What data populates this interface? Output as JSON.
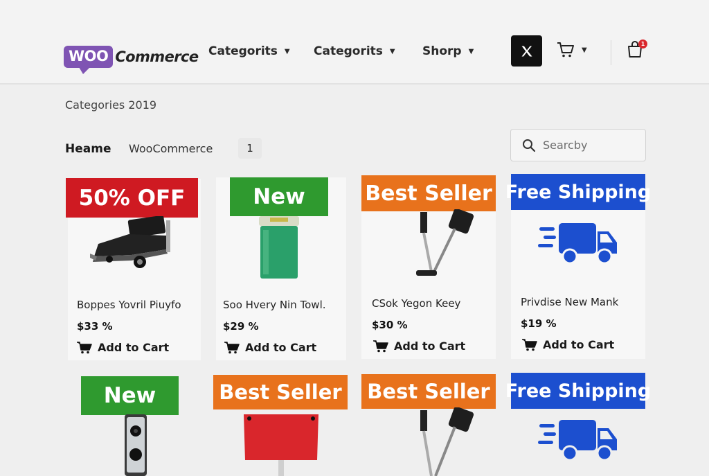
{
  "header": {
    "logo_woo": "WOO",
    "logo_commerce": "Commerce",
    "nav": [
      {
        "label": "Categorits"
      },
      {
        "label": "Categorits"
      },
      {
        "label": "Shorp"
      }
    ],
    "x_label": "𝕏",
    "bag_count": "1"
  },
  "page": {
    "subtitle": "Categories 2019",
    "breadcrumb": {
      "home": "Heame",
      "section": "WooCommerce",
      "page": "1"
    },
    "search_placeholder": "Searcby"
  },
  "colors": {
    "sale_red": "#cf1a22",
    "new_green": "#2f9a2f",
    "best_orange": "#e8721c",
    "shipping_blue": "#1c4fcf"
  },
  "products": [
    {
      "badge": "50% OFF",
      "name": "Boppes Yovril Piuyfo",
      "price": "$33 %",
      "cta": "Add to Cart",
      "image": "black-cart-chair"
    },
    {
      "badge": "New",
      "name": "Soo Hvery Nin Towl.",
      "price": "$29 %",
      "cta": "Add to Cart",
      "image": "green-bin"
    },
    {
      "badge": "Best Seller",
      "name": "CSok Yegon Keey",
      "price": "$30 %",
      "cta": "Add to Cart",
      "image": "stick-vacuum"
    },
    {
      "badge": "Free Shipping",
      "name": "Privdise New Mank",
      "price": "$19 %",
      "cta": "Add to Cart",
      "image": "delivery-truck-icon"
    },
    {
      "badge": "New",
      "image": "video-doorbell"
    },
    {
      "badge": "Best Seller",
      "image": "red-flag-bag"
    },
    {
      "badge": "Best Seller",
      "image": "stick-vacuum"
    },
    {
      "badge": "Free Shipping",
      "image": "delivery-truck-icon"
    }
  ]
}
